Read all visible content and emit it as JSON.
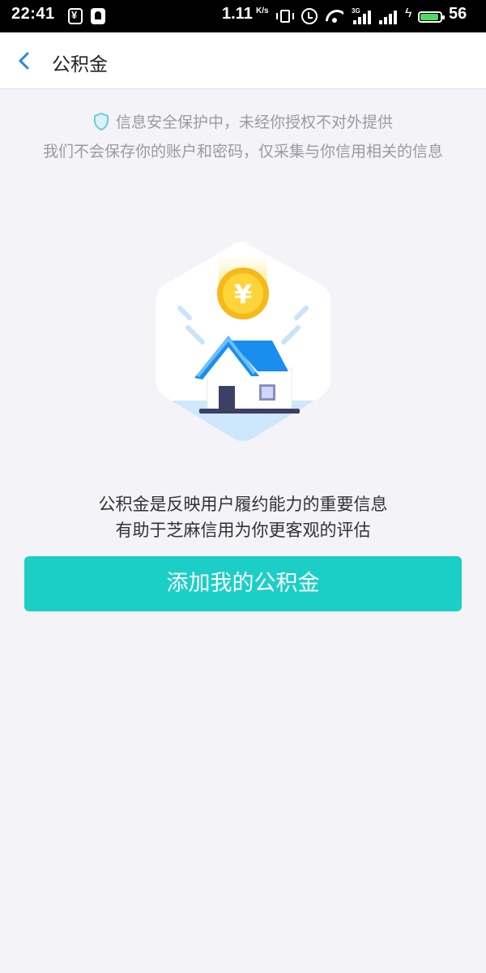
{
  "status_bar": {
    "time": "22:41",
    "net_speed": "1.11",
    "net_speed_unit": "K/s",
    "network_label": "3G",
    "battery_level": "56",
    "battery_color": "#4cd964"
  },
  "nav": {
    "back_icon": "chevron-left-icon",
    "title": "公积金"
  },
  "security_notice": {
    "icon": "shield-icon",
    "line1": "信息安全保护中，未经你授权不对外提供",
    "line2": "我们不会保存你的账户和密码，仅采集与你信用相关的信息"
  },
  "illustration": {
    "coin_symbol": "¥"
  },
  "description": {
    "line1": "公积金是反映用户履约能力的重要信息",
    "line2": "有助于芝麻信用为你更客观的评估"
  },
  "primary_button": {
    "label": "添加我的公积金",
    "color": "#1ccfc6"
  },
  "colors": {
    "accent_blue": "#1e8ae6",
    "background": "#f3f3f8",
    "muted_text": "#9a9aa0"
  }
}
